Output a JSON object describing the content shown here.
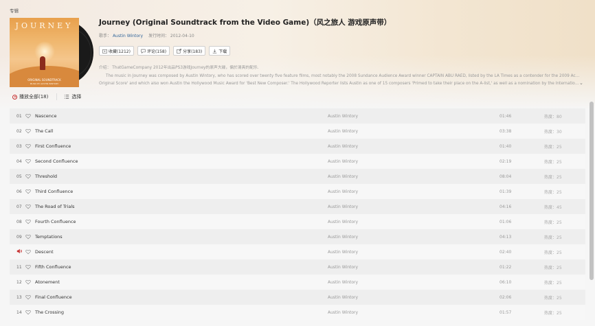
{
  "section_label": "专辑",
  "album": {
    "cover_logo": "JOURNEY",
    "cover_subtitle": "ORIGINAL SOUNDTRACK",
    "cover_subtitle2": "MUSIC BY AUSTIN WINTORY",
    "title": "Journey (Original Soundtrack from the Video Game)（风之旅人 游戏原声带）",
    "artist_label": "歌手：",
    "artist": "Austin Wintory",
    "release_label": "发行时间：",
    "release_date": "2012-04-10"
  },
  "actions": {
    "collect": "收藏(1212)",
    "comment": "评论(158)",
    "share": "分享(183)",
    "download": "下载"
  },
  "description": {
    "line1": "介绍： ThatGameCompany 2012年出品PS3游戏Journey的原声大碟，偏於清爽的配乐.",
    "line2": "The music in Journey was composed by Austin Wintory, who has scored over twenty five feature films, most notably the 2008 Sundance Audience Award winner CAPTAIN ABU RAED, listed by the LA Times as a contender for the 2009 Academy Awards for 'Best",
    "line3": "Original Score' and which also won Austin the Hollywood Music Award for 'Best New Composer.' The Hollywood Reporter lists Austin as one of 15 composers 'Primed to take their place on the A-list,' as well as a nomination by the International Film Music Critic..."
  },
  "toolbar": {
    "play_all": "播放全部(18)",
    "select": "选择"
  },
  "heat_label": "热度：",
  "colors": {
    "accent": "#c62f2f",
    "artist_link": "#31659a"
  },
  "tracks": [
    {
      "num": "01",
      "name": "Nascence",
      "artist": "Austin Wintory",
      "duration": "01:46",
      "heat": "80",
      "playing": false
    },
    {
      "num": "02",
      "name": "The Call",
      "artist": "Austin Wintory",
      "duration": "03:38",
      "heat": "30",
      "playing": false
    },
    {
      "num": "03",
      "name": "First Confluence",
      "artist": "Austin Wintory",
      "duration": "01:40",
      "heat": "25",
      "playing": false
    },
    {
      "num": "04",
      "name": "Second Confluence",
      "artist": "Austin Wintory",
      "duration": "02:19",
      "heat": "25",
      "playing": false
    },
    {
      "num": "05",
      "name": "Threshold",
      "artist": "Austin Wintory",
      "duration": "08:04",
      "heat": "25",
      "playing": false
    },
    {
      "num": "06",
      "name": "Third Confluence",
      "artist": "Austin Wintory",
      "duration": "01:39",
      "heat": "25",
      "playing": false
    },
    {
      "num": "07",
      "name": "The Road of Trials",
      "artist": "Austin Wintory",
      "duration": "04:16",
      "heat": "45",
      "playing": false
    },
    {
      "num": "08",
      "name": "Fourth Confluence",
      "artist": "Austin Wintory",
      "duration": "01:06",
      "heat": "25",
      "playing": false
    },
    {
      "num": "09",
      "name": "Temptations",
      "artist": "Austin Wintory",
      "duration": "04:13",
      "heat": "25",
      "playing": false
    },
    {
      "num": "",
      "name": "Descent",
      "artist": "Austin Wintory",
      "duration": "02:40",
      "heat": "25",
      "playing": true
    },
    {
      "num": "11",
      "name": "Fifth Confluence",
      "artist": "Austin Wintory",
      "duration": "01:22",
      "heat": "25",
      "playing": false
    },
    {
      "num": "12",
      "name": "Atonement",
      "artist": "Austin Wintory",
      "duration": "06:10",
      "heat": "25",
      "playing": false
    },
    {
      "num": "13",
      "name": "Final Confluence",
      "artist": "Austin Wintory",
      "duration": "02:06",
      "heat": "25",
      "playing": false
    },
    {
      "num": "14",
      "name": "The Crossing",
      "artist": "Austin Wintory",
      "duration": "01:57",
      "heat": "25",
      "playing": false
    }
  ]
}
